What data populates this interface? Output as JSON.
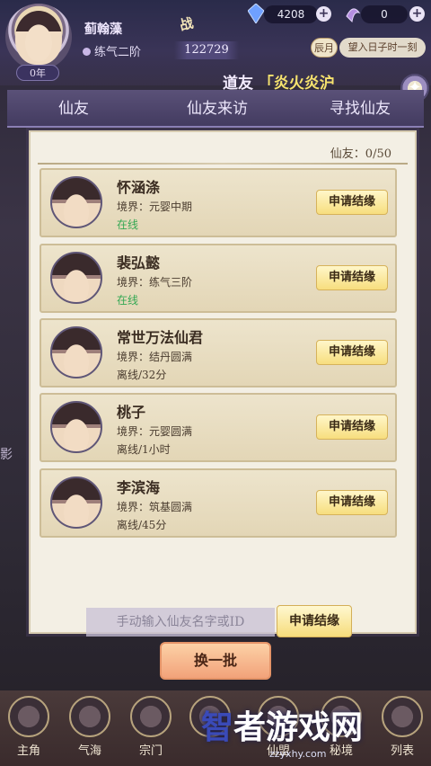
{
  "player": {
    "name": "蓟翰藻",
    "stage": "练气二阶",
    "age": "0年",
    "power_badge": "战",
    "power": "122729"
  },
  "resources": [
    {
      "name": "spirit-stone",
      "value": "4208"
    },
    {
      "name": "gem",
      "value": "0"
    }
  ],
  "clock": {
    "hour": "辰月",
    "text": "望入日子时一刻"
  },
  "announcement": {
    "prefix": "道友",
    "bracket_open": "「",
    "name": "炎火炎沪"
  },
  "tabs": [
    {
      "label": "仙友",
      "active": false
    },
    {
      "label": "仙友来访",
      "active": false
    },
    {
      "label": "寻找仙友",
      "active": true
    }
  ],
  "panel": {
    "count_label": "仙友：0/50"
  },
  "friends": [
    {
      "name": "怀涵涤",
      "realm": "境界：元婴中期",
      "status": "在线",
      "online": true,
      "button": "申请结缘"
    },
    {
      "name": "裴弘懿",
      "realm": "境界：练气三阶",
      "status": "在线",
      "online": true,
      "button": "申请结缘"
    },
    {
      "name": "常世万法仙君",
      "realm": "境界：结丹圆满",
      "status": "离线/32分",
      "online": false,
      "button": "申请结缘"
    },
    {
      "name": "桃子",
      "realm": "境界：元婴圆满",
      "status": "离线/1小时",
      "online": false,
      "button": "申请结缘"
    },
    {
      "name": "李滨海",
      "realm": "境界：筑基圆满",
      "status": "离线/45分",
      "online": false,
      "button": "申请结缘"
    }
  ],
  "search": {
    "placeholder": "手动输入仙友名字或ID",
    "apply_label": "申请结缘"
  },
  "refresh_label": "换一批",
  "bottom_nav": [
    {
      "label": "主角"
    },
    {
      "label": "气海"
    },
    {
      "label": "宗门"
    },
    {
      "label": ""
    },
    {
      "label": "仙盟"
    },
    {
      "label": "秘境"
    },
    {
      "label": "列表"
    }
  ],
  "side_text": "影",
  "watermark": {
    "main_a": "智",
    "main_b": "者游戏网",
    "sub": "zzyxhy.com"
  },
  "colors": {
    "accent_gold": "#f7de7e",
    "online_green": "#34a853",
    "panel_bg": "#f3efe4",
    "refresh_orange": "#f2a27a"
  }
}
